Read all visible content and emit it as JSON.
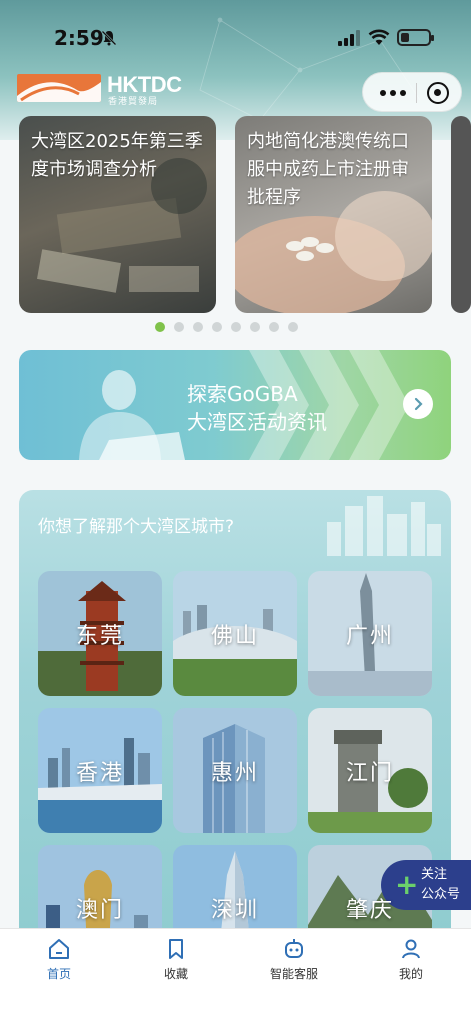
{
  "status_bar": {
    "time": "2:59",
    "battery_level": 0.3
  },
  "header": {
    "logo_text": "HKTDC",
    "logo_subtitle": "香港貿發局"
  },
  "articles": [
    {
      "title": "大湾区2025年第三季度市场调查分析"
    },
    {
      "title": "内地简化港澳传统口服中成药上市注册审批程序"
    }
  ],
  "carousel": {
    "page_count": 8,
    "current_page": 1
  },
  "banner": {
    "line1": "探索GoGBA",
    "line2": "大湾区活动资讯"
  },
  "city_section": {
    "question": "你想了解那个大湾区城市?",
    "cities": [
      "东莞",
      "佛山",
      "广州",
      "香港",
      "惠州",
      "江门",
      "澳门",
      "深圳",
      "肇庆"
    ]
  },
  "follow_button": {
    "line1": "关注",
    "line2": "公众号"
  },
  "tabbar": {
    "items": [
      {
        "label": "首页",
        "icon": "home-icon",
        "active": true
      },
      {
        "label": "收藏",
        "icon": "bookmark-icon",
        "active": false
      },
      {
        "label": "智能客服",
        "icon": "robot-icon",
        "active": false
      },
      {
        "label": "我的",
        "icon": "user-icon",
        "active": false
      }
    ]
  },
  "colors": {
    "accent": "#2f6fb5",
    "logo_orange": "#e8763a",
    "active_dot": "#7fc24a",
    "follow_bg": "#2c3f8c"
  }
}
